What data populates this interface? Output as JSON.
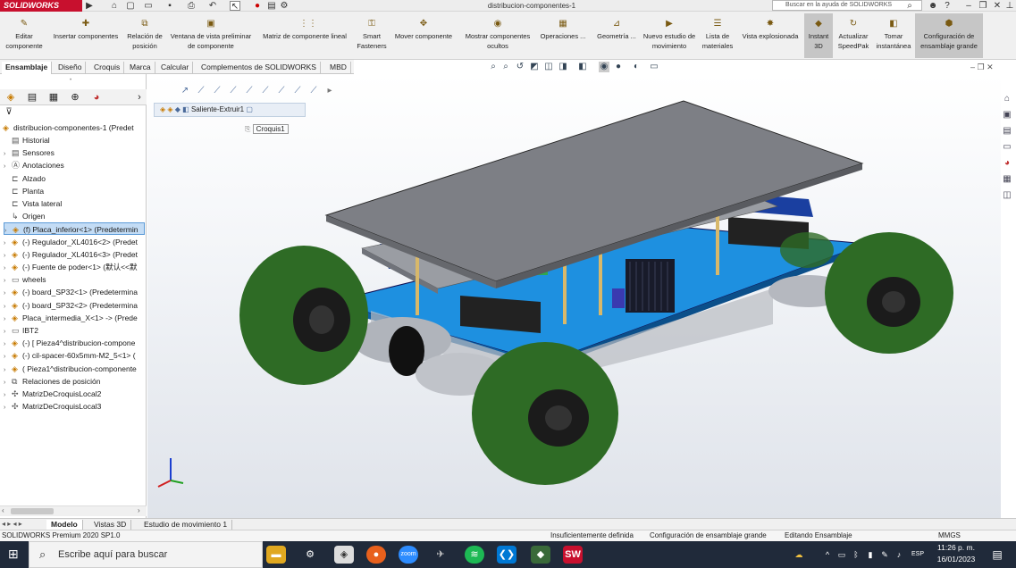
{
  "titlebar": {
    "brand": "SOLIDWORKS",
    "doc_title": "distribucion-componentes-1",
    "help_search_placeholder": "Buscar en la ayuda de SOLIDWORKS"
  },
  "ribbon": [
    {
      "label": "Editar componente"
    },
    {
      "label": "Insertar componentes"
    },
    {
      "label": "Relación de posición"
    },
    {
      "label": "Ventana de vista preliminar de componente"
    },
    {
      "label": "Matriz de componente lineal"
    },
    {
      "label": "Smart Fasteners"
    },
    {
      "label": "Mover componente"
    },
    {
      "label": "Mostrar componentes ocultos"
    },
    {
      "label": "Operaciones ..."
    },
    {
      "label": "Geometría ..."
    },
    {
      "label": "Nuevo estudio de movimiento"
    },
    {
      "label": "Lista de materiales"
    },
    {
      "label": "Vista explosionada"
    },
    {
      "label": "Instant 3D"
    },
    {
      "label": "Actualizar SpeedPak"
    },
    {
      "label": "Tomar instantánea"
    },
    {
      "label": "Configuración de ensamblaje grande"
    }
  ],
  "cmd_tabs": [
    "Ensamblaje",
    "Diseño",
    "Croquis",
    "Marca",
    "Calcular",
    "Complementos de SOLIDWORKS",
    "MBD"
  ],
  "tree": {
    "root": "distribucion-componentes-1  (Predet",
    "items": [
      "Historial",
      "Sensores",
      "Anotaciones",
      "Alzado",
      "Planta",
      "Vista lateral",
      "Origen",
      "(f) Placa_inferior<1> (Predetermin",
      "(-) Regulador_XL4016<2> (Predet",
      "(-) Regulador_XL4016<3> (Predet",
      "(-) Fuente de poder<1> (默认<<默",
      "wheels",
      "(-) board_SP32<1> (Predetermina",
      "(-) board_SP32<2> (Predetermina",
      "Placa_intermedia_X<1> -> (Prede",
      "IBT2",
      "(-) [ Pieza4^distribucion-compone",
      "(-) cil-spacer-60x5mm-M2_5<1> (",
      "( Pieza1^distribucion-componente",
      "Relaciones de posición",
      "MatrizDeCroquisLocal2",
      "MatrizDeCroquisLocal3"
    ]
  },
  "viewport": {
    "breadcrumb": "Saliente-Extruir1",
    "sketch_label": "Croquis1"
  },
  "bottom_tabs": [
    "Modelo",
    "Vistas 3D",
    "Estudio de movimiento 1"
  ],
  "status": {
    "product": "SOLIDWORKS Premium 2020 SP1.0",
    "definition": "Insuficientemente definida",
    "config": "Configuración de ensamblaje grande",
    "mode": "Editando Ensamblaje",
    "units": "MMGS"
  },
  "taskbar": {
    "search_placeholder": "Escribe aquí para buscar",
    "time": "11:26 p. m.",
    "date": "16/01/2023"
  },
  "colors": {
    "brand_red": "#c8102e",
    "wheel_green": "#2e6b25",
    "blue_plate": "#1e90e0",
    "top_plate": "#7d7f85",
    "taskbar": "#202a3a"
  }
}
